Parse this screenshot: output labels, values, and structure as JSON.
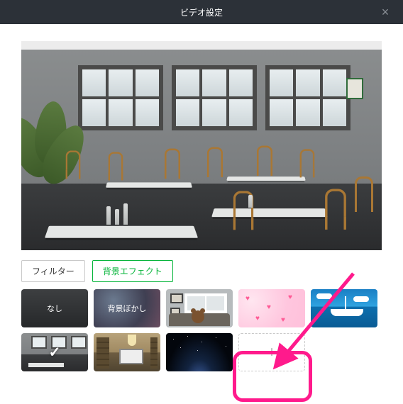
{
  "titlebar": {
    "title": "ビデオ設定"
  },
  "tabs": {
    "filter": "フィルター",
    "background": "背景エフェクト"
  },
  "tiles": {
    "none_label": "なし",
    "blur_label": "背景ぼかし",
    "add_symbol": "+"
  },
  "icons": {
    "close": "×",
    "check": "✓"
  }
}
